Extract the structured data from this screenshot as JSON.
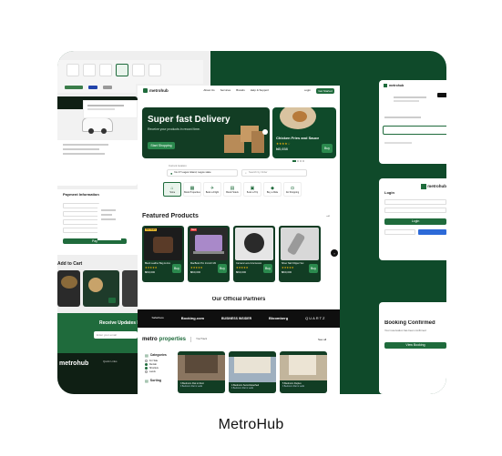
{
  "caption": "MetroHub",
  "colors": {
    "brand_green": "#1f6b3c",
    "dark_green": "#0f4a2a",
    "canvas": "#efefef"
  },
  "logo": {
    "brand": "metrohub",
    "icon": "metrohub-logo-icon"
  },
  "nav": {
    "links": [
      "About Us",
      "Services",
      "Brands",
      "Help & Support"
    ],
    "login": "Login",
    "get_started": "Get Started"
  },
  "hero": {
    "title": "Super fast Delivery",
    "subtitle": "Receive your products in record time.",
    "cta": "Start Shopping",
    "side_title": "Chicken Fries and Sauce",
    "side_price": "₦5,658",
    "side_button": "Buy"
  },
  "search": {
    "location_label": "Current location",
    "location_value": "No 47 Lagos Island, Lagos state",
    "placeholder": "Search by Order"
  },
  "categories": [
    "Home",
    "Book Properties",
    "Book a Flight",
    "Book Hotels",
    "Book a Trip",
    "Buy a Ride",
    "Do Shopping"
  ],
  "featured": {
    "title": "Featured Products",
    "arrow": "→",
    "products": [
      {
        "name": "Black Leather Bag & Accessories",
        "price": "₦60,000",
        "badge": "Hot Deals",
        "button": "Buy"
      },
      {
        "name": "MacBook Pro 14-inch M2 Chip",
        "price": "₦60,000",
        "badge": "New",
        "button": "Buy"
      },
      {
        "name": "Camera Lens & Accessories",
        "price": "₦60,000",
        "badge": "",
        "button": "Buy"
      },
      {
        "name": "Silver Nail Clipper Set",
        "price": "₦60,000",
        "badge": "",
        "button": "Buy"
      }
    ]
  },
  "partners": {
    "title": "Our Official Partners",
    "items": [
      "Safariloos",
      "Booking.com",
      "BUSINESS INSIDER",
      "Bloomberg",
      "QUARTZ"
    ]
  },
  "properties": {
    "brand_a": "metro",
    "brand_b": "properties",
    "divider": "YouTrack",
    "see_all": "See all",
    "filters": {
      "title": "Categories",
      "options": [
        "For Sale",
        "Rentals",
        "Shortlets",
        "Lands"
      ],
      "sorting": "Sorting"
    },
    "listings": [
      {
        "title": "3 Bedroom Flat to Rent",
        "meta": "3 Bedroom Flat in Lekki"
      },
      {
        "title": "4 Bedroom Semi-Detached",
        "meta": "3 Bedroom Flat in Lekki"
      },
      {
        "title": "5 Bedroom Duplex",
        "meta": "3 Bedroom Flat in Lekki"
      }
    ]
  },
  "left_column": {
    "add_to_cart": "Add to Cart",
    "payment_info": "Payment Information",
    "pay_button": "Pay",
    "newsletter": "Receive Updates F",
    "newsletter_placeholder": "Enter your email",
    "footer_brand_a": "metro",
    "footer_brand_b": "hub",
    "footer_col": "Quick Links"
  },
  "right_column": {
    "login_title": "Login",
    "login_button": "Login",
    "booking_title": "Booking Confirmed",
    "booking_text": "Your reservation has been confirmed",
    "booking_button": "View Booking"
  }
}
